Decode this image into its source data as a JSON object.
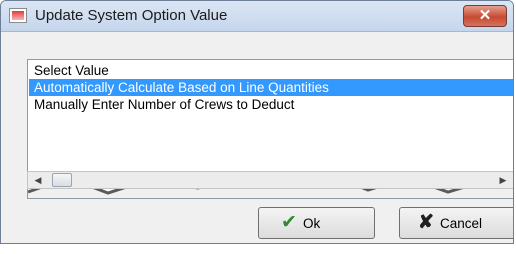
{
  "dialog": {
    "title": "Update System Option Value",
    "close_label": "✕"
  },
  "list": {
    "header": "Select Value",
    "items": [
      {
        "label": "Automatically Calculate Based on Line Quantities",
        "selected": true
      },
      {
        "label": "Manually Enter Number of Crews to Deduct",
        "selected": false
      }
    ]
  },
  "scrollbar": {
    "left_arrow": "◀",
    "right_arrow": "▶"
  },
  "buttons": {
    "ok_icon": "✔",
    "ok_label": "Ok",
    "cancel_icon": "✘",
    "cancel_label": "Cancel"
  },
  "colors": {
    "selection": "#3399ff",
    "close_button": "#c64a32"
  }
}
